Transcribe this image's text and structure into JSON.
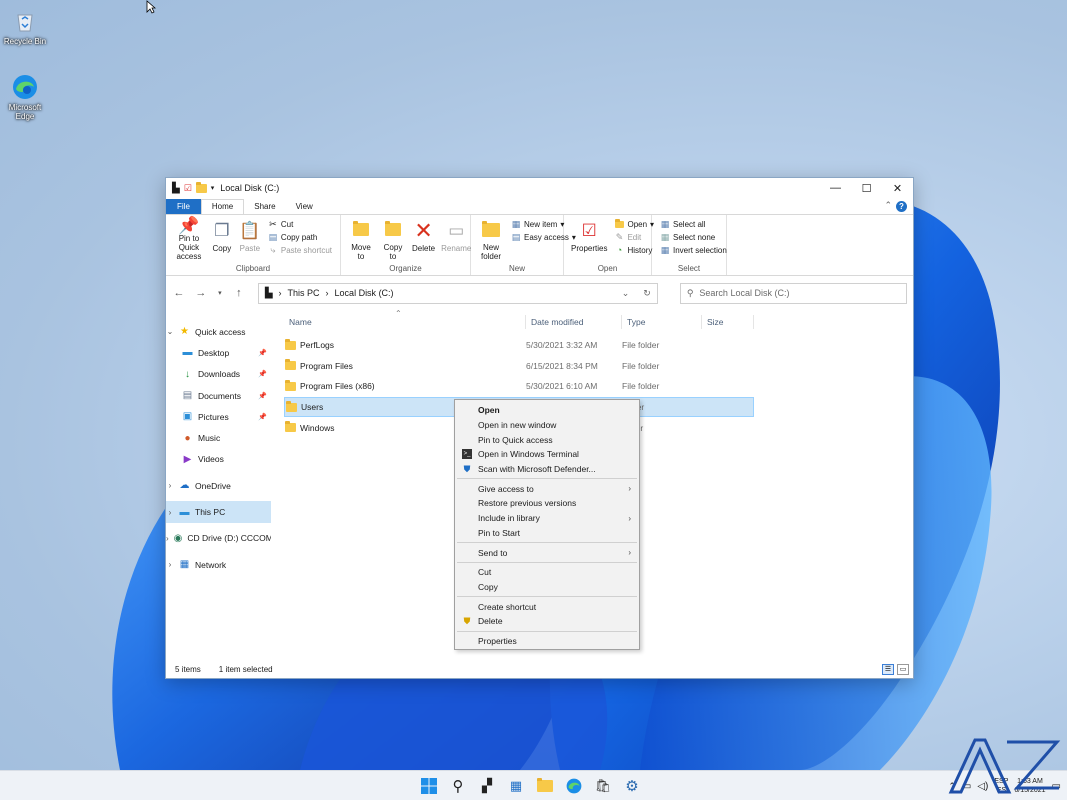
{
  "desktop": {
    "icons": [
      {
        "label": "Recycle Bin",
        "icon": "recycle-bin-icon"
      },
      {
        "label": "Microsoft Edge",
        "icon": "edge-icon"
      }
    ]
  },
  "window": {
    "title": "Local Disk (C:)",
    "tabs": [
      "File",
      "Home",
      "Share",
      "View"
    ],
    "active_tab": "Home",
    "ribbon": {
      "clipboard": {
        "label": "Clipboard",
        "pin_label": "Pin to Quick access",
        "copy_label": "Copy",
        "paste_label": "Paste",
        "cut_label": "Cut",
        "copy_path_label": "Copy path",
        "paste_shortcut_label": "Paste shortcut"
      },
      "organize": {
        "label": "Organize",
        "move_to_label": "Move to",
        "copy_to_label": "Copy to",
        "delete_label": "Delete",
        "rename_label": "Rename"
      },
      "new": {
        "label": "New",
        "new_folder_label": "New folder",
        "new_item_label": "New item",
        "easy_access_label": "Easy access"
      },
      "open": {
        "label": "Open",
        "properties_label": "Properties",
        "open_label": "Open",
        "edit_label": "Edit",
        "history_label": "History"
      },
      "select": {
        "label": "Select",
        "select_all_label": "Select all",
        "select_none_label": "Select none",
        "invert_label": "Invert selection"
      }
    },
    "address": {
      "crumbs": [
        "This PC",
        "Local Disk (C:)"
      ],
      "search_placeholder": "Search Local Disk (C:)"
    },
    "nav": {
      "quick_access": "Quick access",
      "quick_items": [
        "Desktop",
        "Downloads",
        "Documents",
        "Pictures",
        "Music",
        "Videos"
      ],
      "onedrive": "OneDrive",
      "this_pc": "This PC",
      "cd_drive": "CD Drive (D:) CCCOMA",
      "network": "Network"
    },
    "columns": {
      "name": "Name",
      "date": "Date modified",
      "type": "Type",
      "size": "Size"
    },
    "files": [
      {
        "name": "PerfLogs",
        "date": "5/30/2021 3:32 AM",
        "type": "File folder"
      },
      {
        "name": "Program Files",
        "date": "6/15/2021 8:34 PM",
        "type": "File folder"
      },
      {
        "name": "Program Files (x86)",
        "date": "5/30/2021 6:10 AM",
        "type": "File folder"
      },
      {
        "name": "Users",
        "date": "",
        "type": "folder"
      },
      {
        "name": "Windows",
        "date": "",
        "type": "folder"
      }
    ],
    "status": {
      "items": "5 items",
      "selected": "1 item selected"
    }
  },
  "context_menu": {
    "open": "Open",
    "open_new_window": "Open in new window",
    "pin_quick": "Pin to Quick access",
    "open_terminal": "Open in Windows Terminal",
    "scan_defender": "Scan with Microsoft Defender...",
    "give_access": "Give access to",
    "restore": "Restore previous versions",
    "include_library": "Include in library",
    "pin_start": "Pin to Start",
    "send_to": "Send to",
    "cut": "Cut",
    "copy": "Copy",
    "create_shortcut": "Create shortcut",
    "delete": "Delete",
    "properties": "Properties"
  },
  "taskbar": {
    "lang": "ESP",
    "lang_sub": "ES",
    "time": "1:53 AM",
    "date": "6/15/2021"
  },
  "colors": {
    "accent": "#1f6fc6",
    "selection": "#cce4f7"
  }
}
